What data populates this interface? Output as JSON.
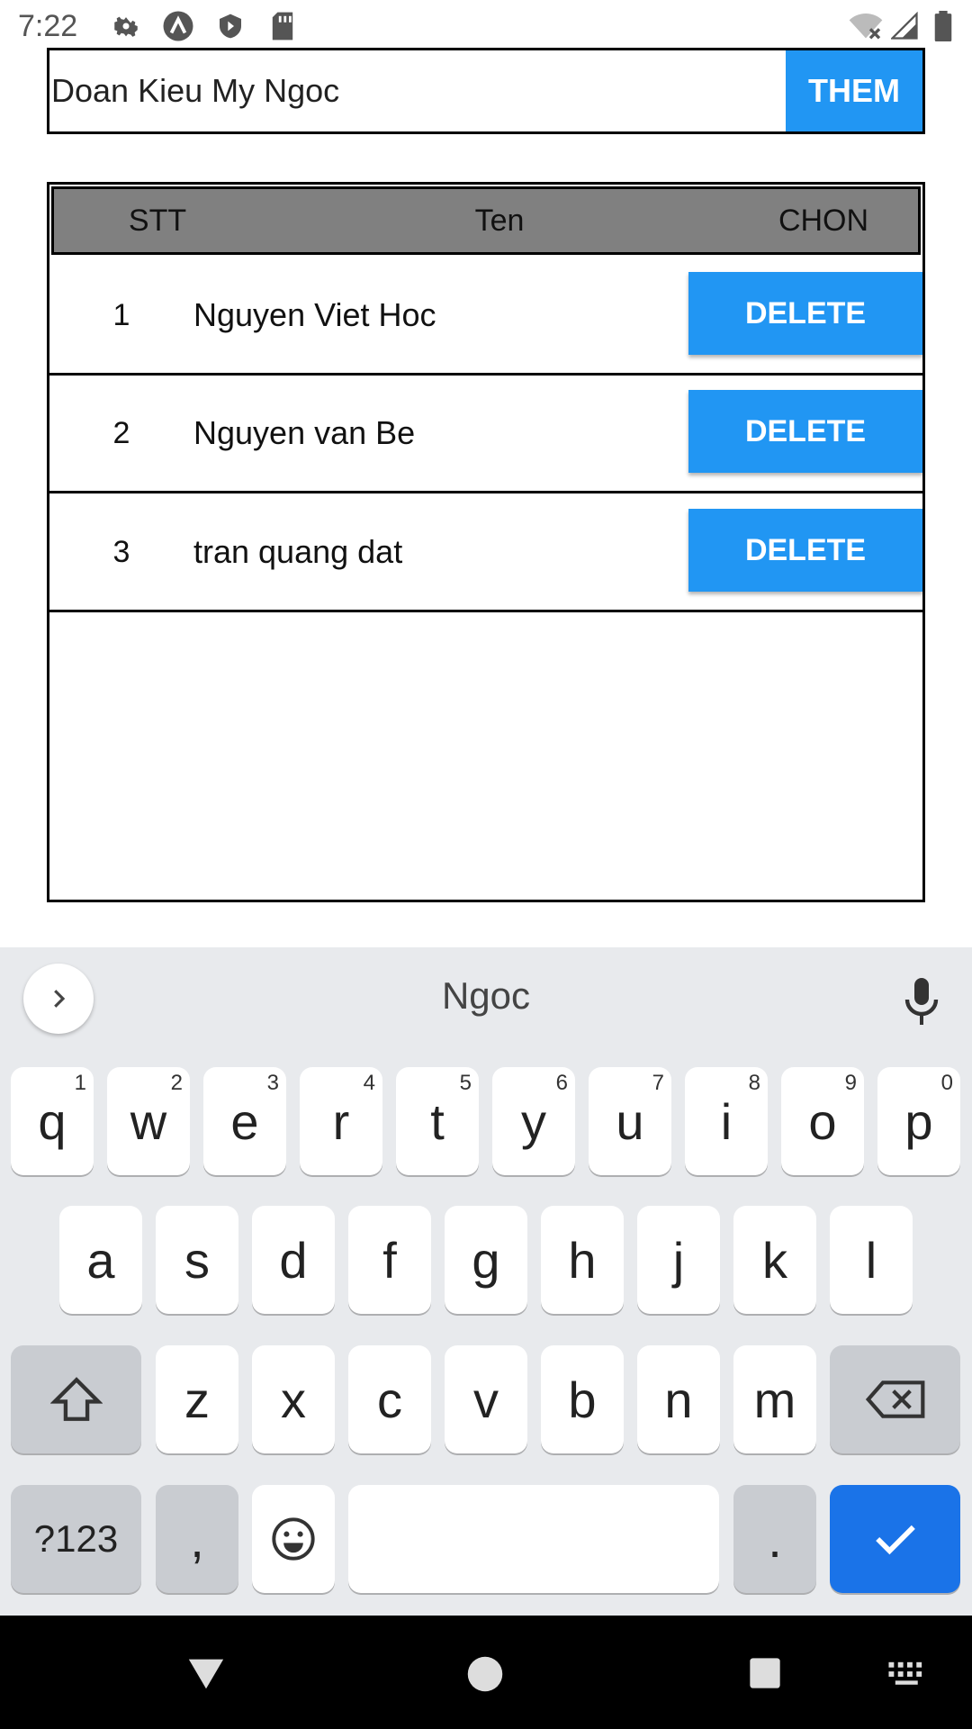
{
  "status_bar": {
    "time": "7:22",
    "icons": [
      "settings-gear-icon",
      "app-a-icon",
      "shield-icon",
      "sd-card-icon",
      "wifi-off-icon",
      "signal-icon",
      "battery-icon"
    ]
  },
  "input": {
    "value": "Doan Kieu My Ngoc",
    "add_label": "THEM"
  },
  "table": {
    "headers": [
      "STT",
      "Ten",
      "CHON"
    ],
    "rows": [
      {
        "stt": "1",
        "name": "Nguyen Viet Hoc",
        "action": "DELETE"
      },
      {
        "stt": "2",
        "name": "Nguyen van Be",
        "action": "DELETE"
      },
      {
        "stt": "3",
        "name": "tran quang dat",
        "action": "DELETE"
      }
    ]
  },
  "keyboard": {
    "suggestion": "Ngoc",
    "row1": [
      "q",
      "w",
      "e",
      "r",
      "t",
      "y",
      "u",
      "i",
      "o",
      "p"
    ],
    "row1_hints": [
      "1",
      "2",
      "3",
      "4",
      "5",
      "6",
      "7",
      "8",
      "9",
      "0"
    ],
    "row2": [
      "a",
      "s",
      "d",
      "f",
      "g",
      "h",
      "j",
      "k",
      "l"
    ],
    "row3": [
      "z",
      "x",
      "c",
      "v",
      "b",
      "n",
      "m"
    ],
    "symbols_label": "?123",
    "comma": ",",
    "period": "."
  },
  "colors": {
    "accent": "#2196F3",
    "header_bg": "#808080",
    "keyboard_bg": "#e8eaed",
    "action_key": "#1a73e8"
  }
}
